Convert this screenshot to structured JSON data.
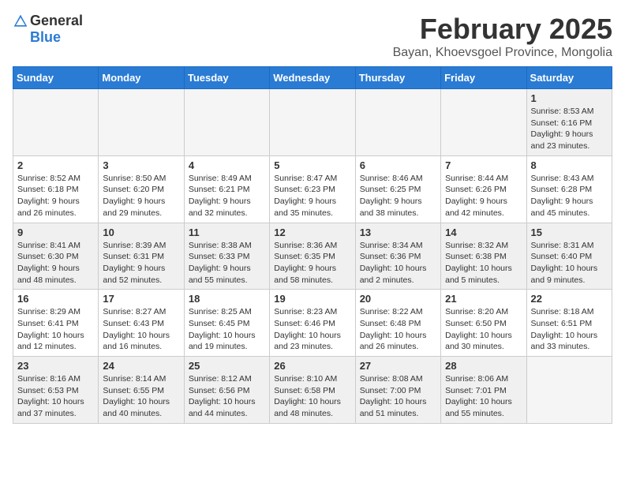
{
  "header": {
    "logo_general": "General",
    "logo_blue": "Blue",
    "month_title": "February 2025",
    "location": "Bayan, Khoevsgoel Province, Mongolia"
  },
  "weekdays": [
    "Sunday",
    "Monday",
    "Tuesday",
    "Wednesday",
    "Thursday",
    "Friday",
    "Saturday"
  ],
  "weeks": [
    [
      {
        "day": "",
        "info": ""
      },
      {
        "day": "",
        "info": ""
      },
      {
        "day": "",
        "info": ""
      },
      {
        "day": "",
        "info": ""
      },
      {
        "day": "",
        "info": ""
      },
      {
        "day": "",
        "info": ""
      },
      {
        "day": "1",
        "info": "Sunrise: 8:53 AM\nSunset: 6:16 PM\nDaylight: 9 hours\nand 23 minutes."
      }
    ],
    [
      {
        "day": "2",
        "info": "Sunrise: 8:52 AM\nSunset: 6:18 PM\nDaylight: 9 hours\nand 26 minutes."
      },
      {
        "day": "3",
        "info": "Sunrise: 8:50 AM\nSunset: 6:20 PM\nDaylight: 9 hours\nand 29 minutes."
      },
      {
        "day": "4",
        "info": "Sunrise: 8:49 AM\nSunset: 6:21 PM\nDaylight: 9 hours\nand 32 minutes."
      },
      {
        "day": "5",
        "info": "Sunrise: 8:47 AM\nSunset: 6:23 PM\nDaylight: 9 hours\nand 35 minutes."
      },
      {
        "day": "6",
        "info": "Sunrise: 8:46 AM\nSunset: 6:25 PM\nDaylight: 9 hours\nand 38 minutes."
      },
      {
        "day": "7",
        "info": "Sunrise: 8:44 AM\nSunset: 6:26 PM\nDaylight: 9 hours\nand 42 minutes."
      },
      {
        "day": "8",
        "info": "Sunrise: 8:43 AM\nSunset: 6:28 PM\nDaylight: 9 hours\nand 45 minutes."
      }
    ],
    [
      {
        "day": "9",
        "info": "Sunrise: 8:41 AM\nSunset: 6:30 PM\nDaylight: 9 hours\nand 48 minutes."
      },
      {
        "day": "10",
        "info": "Sunrise: 8:39 AM\nSunset: 6:31 PM\nDaylight: 9 hours\nand 52 minutes."
      },
      {
        "day": "11",
        "info": "Sunrise: 8:38 AM\nSunset: 6:33 PM\nDaylight: 9 hours\nand 55 minutes."
      },
      {
        "day": "12",
        "info": "Sunrise: 8:36 AM\nSunset: 6:35 PM\nDaylight: 9 hours\nand 58 minutes."
      },
      {
        "day": "13",
        "info": "Sunrise: 8:34 AM\nSunset: 6:36 PM\nDaylight: 10 hours\nand 2 minutes."
      },
      {
        "day": "14",
        "info": "Sunrise: 8:32 AM\nSunset: 6:38 PM\nDaylight: 10 hours\nand 5 minutes."
      },
      {
        "day": "15",
        "info": "Sunrise: 8:31 AM\nSunset: 6:40 PM\nDaylight: 10 hours\nand 9 minutes."
      }
    ],
    [
      {
        "day": "16",
        "info": "Sunrise: 8:29 AM\nSunset: 6:41 PM\nDaylight: 10 hours\nand 12 minutes."
      },
      {
        "day": "17",
        "info": "Sunrise: 8:27 AM\nSunset: 6:43 PM\nDaylight: 10 hours\nand 16 minutes."
      },
      {
        "day": "18",
        "info": "Sunrise: 8:25 AM\nSunset: 6:45 PM\nDaylight: 10 hours\nand 19 minutes."
      },
      {
        "day": "19",
        "info": "Sunrise: 8:23 AM\nSunset: 6:46 PM\nDaylight: 10 hours\nand 23 minutes."
      },
      {
        "day": "20",
        "info": "Sunrise: 8:22 AM\nSunset: 6:48 PM\nDaylight: 10 hours\nand 26 minutes."
      },
      {
        "day": "21",
        "info": "Sunrise: 8:20 AM\nSunset: 6:50 PM\nDaylight: 10 hours\nand 30 minutes."
      },
      {
        "day": "22",
        "info": "Sunrise: 8:18 AM\nSunset: 6:51 PM\nDaylight: 10 hours\nand 33 minutes."
      }
    ],
    [
      {
        "day": "23",
        "info": "Sunrise: 8:16 AM\nSunset: 6:53 PM\nDaylight: 10 hours\nand 37 minutes."
      },
      {
        "day": "24",
        "info": "Sunrise: 8:14 AM\nSunset: 6:55 PM\nDaylight: 10 hours\nand 40 minutes."
      },
      {
        "day": "25",
        "info": "Sunrise: 8:12 AM\nSunset: 6:56 PM\nDaylight: 10 hours\nand 44 minutes."
      },
      {
        "day": "26",
        "info": "Sunrise: 8:10 AM\nSunset: 6:58 PM\nDaylight: 10 hours\nand 48 minutes."
      },
      {
        "day": "27",
        "info": "Sunrise: 8:08 AM\nSunset: 7:00 PM\nDaylight: 10 hours\nand 51 minutes."
      },
      {
        "day": "28",
        "info": "Sunrise: 8:06 AM\nSunset: 7:01 PM\nDaylight: 10 hours\nand 55 minutes."
      },
      {
        "day": "",
        "info": ""
      }
    ]
  ]
}
